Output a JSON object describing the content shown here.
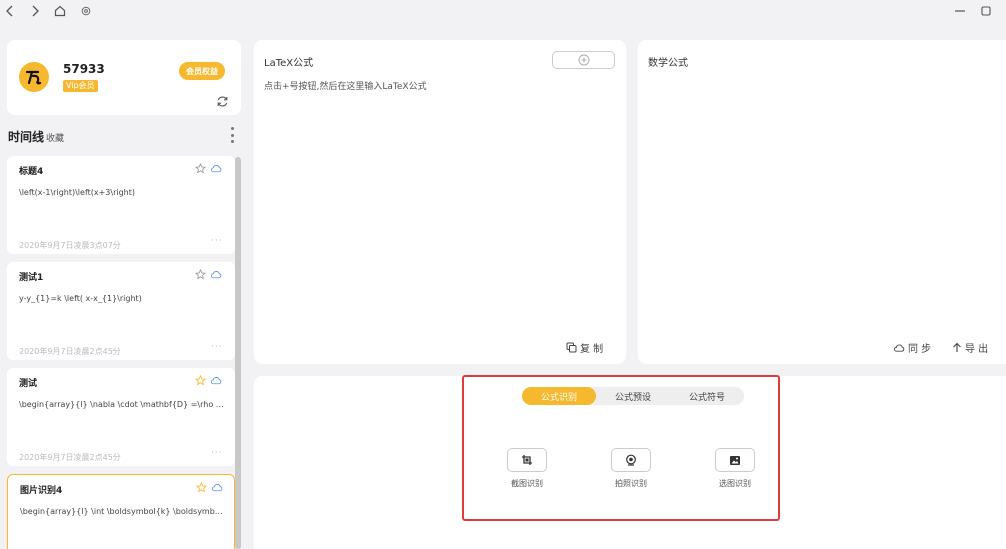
{
  "profile": {
    "username": "57933",
    "vip_tag": "Vip会员",
    "member_button": "会员权益"
  },
  "timeline": {
    "title": "时间线",
    "favorites": "收藏",
    "items": [
      {
        "title": "标题4",
        "formula": "\\left(x-1\\right)\\left(x+3\\right)",
        "date": "2020年9月7日凌晨3点07分",
        "starred": false
      },
      {
        "title": "测试1",
        "formula": "y-y_{1}=k \\left( x-x_{1}\\right)",
        "date": "2020年9月7日凌晨2点45分",
        "starred": false
      },
      {
        "title": "测试",
        "formula": "\\begin{array}{l} \\nabla \\cdot \\mathbf{D} =\\rho _...",
        "date": "2020年9月7日凌晨2点45分",
        "starred": true
      },
      {
        "title": "图片识别4",
        "formula": "\\begin{array}{l} \\int \\boldsymbol{k} \\boldsymbol{...",
        "date": "",
        "starred": true
      }
    ]
  },
  "latex_panel": {
    "title": "LaTeX公式",
    "hint": "点击+号按钮,然后在这里输入LaTeX公式",
    "copy_label": "复 制"
  },
  "math_panel": {
    "title": "数学公式",
    "sync_label": "同 步",
    "export_label": "导 出"
  },
  "recognition": {
    "tabs": [
      {
        "label": "公式识别",
        "active": true
      },
      {
        "label": "公式预设",
        "active": false
      },
      {
        "label": "公式符号",
        "active": false
      }
    ],
    "tools": [
      {
        "label": "截图识别",
        "icon": "crop-icon"
      },
      {
        "label": "拍照识别",
        "icon": "camera-icon"
      },
      {
        "label": "选图识别",
        "icon": "image-icon"
      }
    ]
  },
  "colors": {
    "accent": "#f5b82e",
    "highlight": "#e03a3a",
    "cloud": "#5b8de6"
  }
}
